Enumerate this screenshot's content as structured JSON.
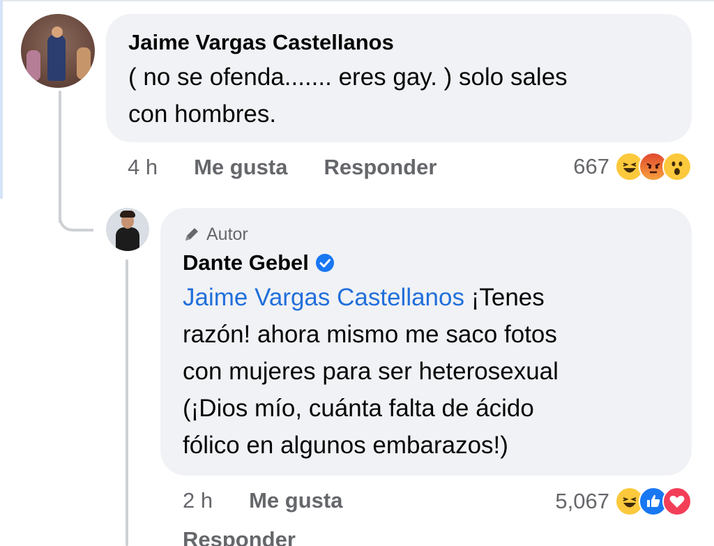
{
  "comment": {
    "author": "Jaime Vargas Castellanos",
    "text_line1": "( no se ofenda....... eres gay. ) solo sales",
    "text_line2": "con hombres.",
    "time": "4 h",
    "like_label": "Me gusta",
    "reply_label": "Responder",
    "reaction_count": "667",
    "reactions": [
      "haha",
      "angry",
      "wow"
    ]
  },
  "reply": {
    "author_tag": "Autor",
    "author": "Dante Gebel",
    "verified": true,
    "mention": "Jaime Vargas Castellanos",
    "text_line1_rest": " ¡Tenes",
    "text_line2": "razón! ahora mismo me saco fotos",
    "text_line3": "con mujeres para ser heterosexual",
    "text_line4": "(¡Dios mío, cuánta falta de ácido",
    "text_line5": "fólico en algunos embarazos!)",
    "time": "2 h",
    "like_label": "Me gusta",
    "reply_label": "Responder",
    "reaction_count": "5,067",
    "reactions": [
      "haha",
      "like",
      "love"
    ]
  },
  "colors": {
    "bubble": "#f0f2f5",
    "mention": "#216fdb",
    "meta_text": "#65676b",
    "verified": "#1877f2"
  }
}
